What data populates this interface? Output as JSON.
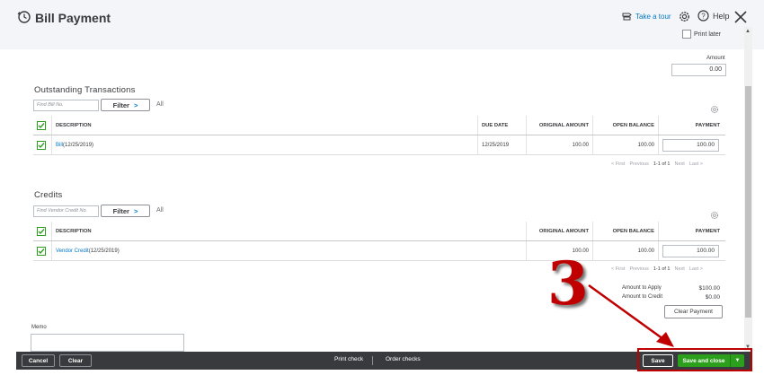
{
  "header": {
    "title": "Bill Payment",
    "take_tour": "Take a tour",
    "help": "Help",
    "print_later": "Print later"
  },
  "amount": {
    "label": "Amount",
    "value": "0.00"
  },
  "outstanding": {
    "title": "Outstanding Transactions",
    "find_placeholder": "Find Bill No.",
    "filter_label": "Filter",
    "all_label": "All",
    "columns": [
      "DESCRIPTION",
      "DUE DATE",
      "ORIGINAL AMOUNT",
      "OPEN BALANCE",
      "PAYMENT"
    ],
    "rows": [
      {
        "link": "Bill",
        "desc": "(12/25/2019)",
        "due_date": "12/25/2019",
        "original": "100.00",
        "open": "100.00",
        "payment": "100.00"
      }
    ],
    "pager": {
      "first": "< First",
      "prev": "Previous",
      "range": "1-1 of 1",
      "next": "Next",
      "last": "Last >"
    }
  },
  "credits": {
    "title": "Credits",
    "find_placeholder": "Find Vendor Credit No.",
    "filter_label": "Filter",
    "all_label": "All",
    "columns": [
      "DESCRIPTION",
      "ORIGINAL AMOUNT",
      "OPEN BALANCE",
      "PAYMENT"
    ],
    "rows": [
      {
        "link": "Vendor Credit",
        "desc": "(12/25/2019)",
        "original": "100.00",
        "open": "100.00",
        "payment": "100.00"
      }
    ],
    "pager": {
      "first": "< First",
      "prev": "Previous",
      "range": "1-1 of 1",
      "next": "Next",
      "last": "Last >"
    }
  },
  "totals": {
    "apply_label": "Amount to Apply",
    "apply_value": "$100.00",
    "credit_label": "Amount to Credit",
    "credit_value": "$0.00",
    "clear_payment": "Clear Payment"
  },
  "memo": {
    "label": "Memo",
    "value": ""
  },
  "footer": {
    "cancel": "Cancel",
    "clear": "Clear",
    "print_check": "Print check",
    "order_checks": "Order checks",
    "save": "Save",
    "save_and_close": "Save and close"
  },
  "annotation": {
    "number": "3",
    "color": "#c00000"
  },
  "colors": {
    "accent_green": "#2ca01c",
    "link_blue": "#0077c5",
    "footer_bg": "#393a3d"
  }
}
